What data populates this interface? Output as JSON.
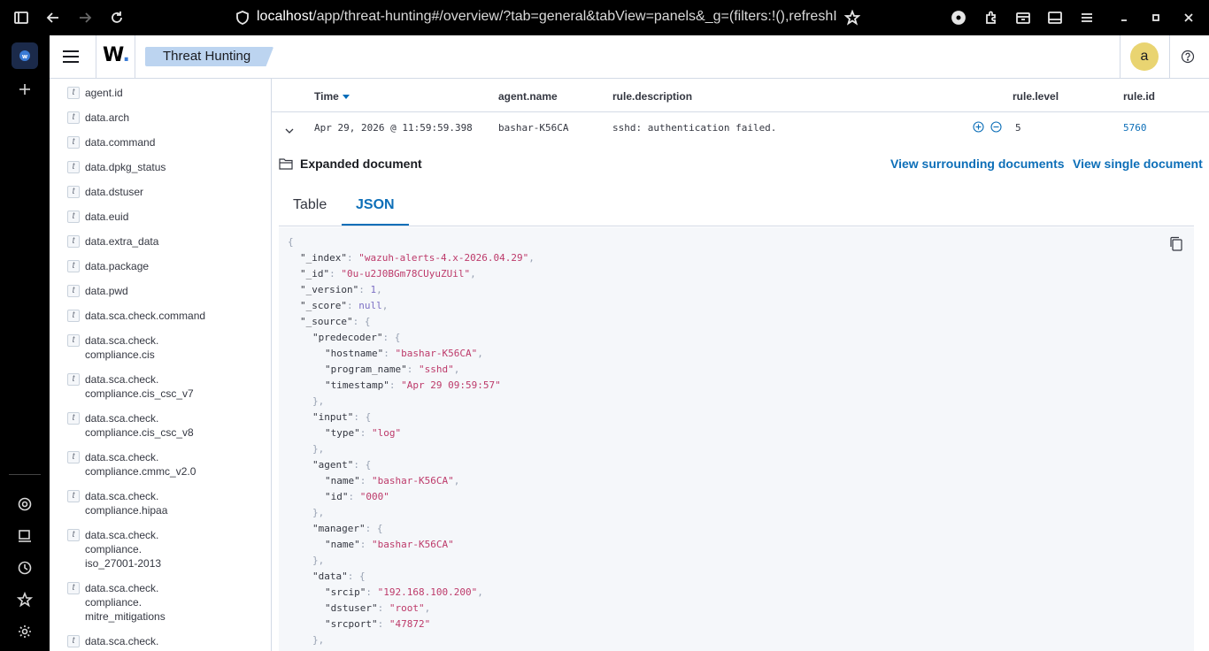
{
  "browser": {
    "url_host": "localhost",
    "url_rest": "/app/threat-hunting#/overview/?tab=general&tabView=panels&_g=(filters:!(),refreshI"
  },
  "app": {
    "logo_text": "W",
    "logo_dot": ".",
    "breadcrumb": "Threat Hunting",
    "avatar_letter": "a"
  },
  "fields": [
    {
      "type": "t",
      "name": "agent.id"
    },
    {
      "type": "t",
      "name": "data.arch"
    },
    {
      "type": "t",
      "name": "data.command"
    },
    {
      "type": "t",
      "name": "data.dpkg_status"
    },
    {
      "type": "t",
      "name": "data.dstuser"
    },
    {
      "type": "t",
      "name": "data.euid"
    },
    {
      "type": "t",
      "name": "data.extra_data"
    },
    {
      "type": "t",
      "name": "data.package"
    },
    {
      "type": "t",
      "name": "data.pwd"
    },
    {
      "type": "t",
      "name": "data.sca.check.command"
    },
    {
      "type": "t",
      "name": "data.sca.check.\ncompliance.cis"
    },
    {
      "type": "t",
      "name": "data.sca.check.\ncompliance.cis_csc_v7"
    },
    {
      "type": "t",
      "name": "data.sca.check.\ncompliance.cis_csc_v8"
    },
    {
      "type": "t",
      "name": "data.sca.check.\ncompliance.cmmc_v2.0"
    },
    {
      "type": "t",
      "name": "data.sca.check.\ncompliance.hipaa"
    },
    {
      "type": "t",
      "name": "data.sca.check.\ncompliance.\niso_27001-2013"
    },
    {
      "type": "t",
      "name": "data.sca.check.\ncompliance.\nmitre_mitigations"
    },
    {
      "type": "t",
      "name": "data.sca.check."
    }
  ],
  "table": {
    "columns": {
      "time": "Time",
      "agent_name": "agent.name",
      "rule_description": "rule.description",
      "rule_level": "rule.level",
      "rule_id": "rule.id"
    },
    "row": {
      "time": "Apr 29, 2026 @ 11:59:59.398",
      "agent_name": "bashar-K56CA",
      "rule_description": "sshd: authentication failed.",
      "rule_level": "5",
      "rule_id": "5760"
    }
  },
  "expanded": {
    "title": "Expanded document",
    "surrounding_link": "View surrounding documents",
    "single_link": "View single document",
    "tabs": [
      "Table",
      "JSON"
    ],
    "active_tab": "JSON"
  },
  "json_lines": [
    {
      "i": 0,
      "parts": [
        [
          "p",
          "{"
        ]
      ]
    },
    {
      "i": 1,
      "parts": [
        [
          "k",
          "\"_index\""
        ],
        [
          "p",
          ": "
        ],
        [
          "s",
          "\"wazuh-alerts-4.x-2026.04.29\""
        ],
        [
          "p",
          ","
        ]
      ]
    },
    {
      "i": 1,
      "parts": [
        [
          "k",
          "\"_id\""
        ],
        [
          "p",
          ": "
        ],
        [
          "s",
          "\"0u-u2J0BGm78CUyuZUil\""
        ],
        [
          "p",
          ","
        ]
      ]
    },
    {
      "i": 1,
      "parts": [
        [
          "k",
          "\"_version\""
        ],
        [
          "p",
          ": "
        ],
        [
          "n",
          "1"
        ],
        [
          "p",
          ","
        ]
      ]
    },
    {
      "i": 1,
      "parts": [
        [
          "k",
          "\"_score\""
        ],
        [
          "p",
          ": "
        ],
        [
          "n",
          "null"
        ],
        [
          "p",
          ","
        ]
      ]
    },
    {
      "i": 1,
      "parts": [
        [
          "k",
          "\"_source\""
        ],
        [
          "p",
          ": {"
        ]
      ]
    },
    {
      "i": 2,
      "parts": [
        [
          "k",
          "\"predecoder\""
        ],
        [
          "p",
          ": {"
        ]
      ]
    },
    {
      "i": 3,
      "parts": [
        [
          "k",
          "\"hostname\""
        ],
        [
          "p",
          ": "
        ],
        [
          "s",
          "\"bashar-K56CA\""
        ],
        [
          "p",
          ","
        ]
      ]
    },
    {
      "i": 3,
      "parts": [
        [
          "k",
          "\"program_name\""
        ],
        [
          "p",
          ": "
        ],
        [
          "s",
          "\"sshd\""
        ],
        [
          "p",
          ","
        ]
      ]
    },
    {
      "i": 3,
      "parts": [
        [
          "k",
          "\"timestamp\""
        ],
        [
          "p",
          ": "
        ],
        [
          "s",
          "\"Apr 29 09:59:57\""
        ]
      ]
    },
    {
      "i": 2,
      "parts": [
        [
          "p",
          "},"
        ]
      ]
    },
    {
      "i": 2,
      "parts": [
        [
          "k",
          "\"input\""
        ],
        [
          "p",
          ": {"
        ]
      ]
    },
    {
      "i": 3,
      "parts": [
        [
          "k",
          "\"type\""
        ],
        [
          "p",
          ": "
        ],
        [
          "s",
          "\"log\""
        ]
      ]
    },
    {
      "i": 2,
      "parts": [
        [
          "p",
          "},"
        ]
      ]
    },
    {
      "i": 2,
      "parts": [
        [
          "k",
          "\"agent\""
        ],
        [
          "p",
          ": {"
        ]
      ]
    },
    {
      "i": 3,
      "parts": [
        [
          "k",
          "\"name\""
        ],
        [
          "p",
          ": "
        ],
        [
          "s",
          "\"bashar-K56CA\""
        ],
        [
          "p",
          ","
        ]
      ]
    },
    {
      "i": 3,
      "parts": [
        [
          "k",
          "\"id\""
        ],
        [
          "p",
          ": "
        ],
        [
          "s",
          "\"000\""
        ]
      ]
    },
    {
      "i": 2,
      "parts": [
        [
          "p",
          "},"
        ]
      ]
    },
    {
      "i": 2,
      "parts": [
        [
          "k",
          "\"manager\""
        ],
        [
          "p",
          ": {"
        ]
      ]
    },
    {
      "i": 3,
      "parts": [
        [
          "k",
          "\"name\""
        ],
        [
          "p",
          ": "
        ],
        [
          "s",
          "\"bashar-K56CA\""
        ]
      ]
    },
    {
      "i": 2,
      "parts": [
        [
          "p",
          "},"
        ]
      ]
    },
    {
      "i": 2,
      "parts": [
        [
          "k",
          "\"data\""
        ],
        [
          "p",
          ": {"
        ]
      ]
    },
    {
      "i": 3,
      "parts": [
        [
          "k",
          "\"srcip\""
        ],
        [
          "p",
          ": "
        ],
        [
          "s",
          "\"192.168.100.200\""
        ],
        [
          "p",
          ","
        ]
      ]
    },
    {
      "i": 3,
      "parts": [
        [
          "k",
          "\"dstuser\""
        ],
        [
          "p",
          ": "
        ],
        [
          "s",
          "\"root\""
        ],
        [
          "p",
          ","
        ]
      ]
    },
    {
      "i": 3,
      "parts": [
        [
          "k",
          "\"srcport\""
        ],
        [
          "p",
          ": "
        ],
        [
          "s",
          "\"47872\""
        ]
      ]
    },
    {
      "i": 2,
      "parts": [
        [
          "p",
          "},"
        ]
      ]
    }
  ],
  "colors": {
    "link": "#0d6fb8",
    "breadcrumb_bg": "#bcd4f0",
    "avatar_bg": "#e9d471",
    "json_string": "#bd3a6a",
    "json_number": "#7c6fc4"
  }
}
